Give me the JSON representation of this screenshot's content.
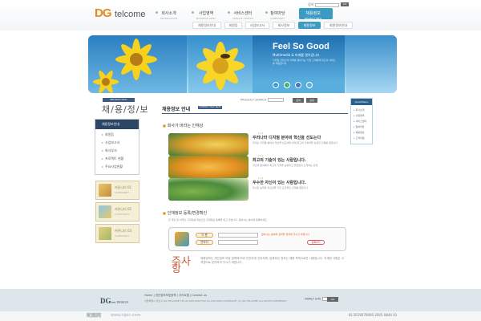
{
  "header": {
    "logo_prefix": "DG",
    "logo_suffix": "telcome",
    "nav": [
      {
        "label": "회사소개",
        "sub": "INFORMATION"
      },
      {
        "label": "사업영역",
        "sub": "BUSINESS AREA"
      },
      {
        "label": "서비스센터",
        "sub": "SERVICE CENTER"
      },
      {
        "label": "참여마당",
        "sub": "COMMUNITY"
      },
      {
        "label": "채용정보",
        "sub": "RECRUIT INFO"
      }
    ],
    "search_label": "검색",
    "search_button": "GO",
    "subtabs": [
      "채용정보안내",
      "회원등",
      "사업보고서",
      "회사정보",
      "채용정보",
      "회원정보안내"
    ]
  },
  "banner": {
    "headline": "Feel So Good",
    "subline": "Multimedia & 미래를 열어갑니다",
    "desc": "디지털 컨텐츠의 미래를 열어가는 기업 고객에게 최고의 서비스를 제공합니다"
  },
  "left": {
    "tag": "RECRUIT INFO",
    "title": "채/용/정/보",
    "menu_header": "채용정보안내",
    "menu": [
      "회원등",
      "사업보고서",
      "회사부서",
      "프로젝트 현황",
      "주요사업현황"
    ],
    "community": [
      {
        "title": "커뮤니티 01",
        "sub": "COMMUNITY"
      },
      {
        "title": "커뮤니티 02",
        "sub": "COMMUNITY"
      },
      {
        "title": "커뮤니티 03",
        "sub": "COMMUNITY"
      }
    ]
  },
  "quick": {
    "title": "QuickMenu",
    "items": [
      "회사소개",
      "사업영역",
      "서비스센터",
      "참여마당",
      "채용정보",
      "고객지원"
    ]
  },
  "content": {
    "title": "채용정보 안내",
    "title_badge": "COMPANY HELP DESK",
    "search_label": "PRODUCT SEARCH",
    "search_btn1": "검색",
    "search_btn2": "상세",
    "section1": "회사가 바라는 인재상",
    "ideals": [
      {
        "title": "우리나라 디지털 분야의 혁신을 선도는다",
        "desc": "우리는 디지털 분야의 혁신을 선도하며 세계 최고의 기술력을 보유한 인재를 원합니다"
      },
      {
        "title": "최고의 기술이 있는 사람입니다.",
        "desc": "자신의 분야에서 최고의 기술을 보유하고 끊임없이 노력하는 인재"
      },
      {
        "title": "우수한 자신이 있는 사람입니다.",
        "desc": "우수한 능력과 자신감을 가진 도전적인 인재를 원합니다"
      }
    ],
    "section2": "인재정보 등록/변경확인",
    "intro": "전 국민 및 외국인 구직자를 대상으로 인재정보 등록을 받고 있습니다. 원하시는 분야에 등록하세요.",
    "form": {
      "label1": "이 름",
      "label2": "연락처",
      "note": "원하시는 분야와 실력을 입력해 주시기 바랍니다",
      "button": "등록하기"
    },
    "joo_mark": "주사항",
    "joo_text": "채용정보는 개인정보 보호 정책에 따라 안전하게 관리되며, 등록하신 정보는 채용 목적으로만 사용됩니다. 자세한 사항은 고객센터로 문의하여 주시기 바랍니다."
  },
  "footer": {
    "logo": "DG",
    "logo_small": "tent DESIGN",
    "links": "Home | 개인정보보호정책 | 사이트맵 | Contact us",
    "address": "서울특별시 강남구 DG TELCOME TEL 02-000-0000 FAX 02-000-0000 COPYRIGHT (C) DG TELCOME ALL RIGHTS RESERVED",
    "family_label": "FAMILY SITE",
    "family_go": "GO",
    "wm1": "昵图网",
    "wm2": "www.nipic.com",
    "wm3": "ID:2619070000 2005 0844 01"
  }
}
